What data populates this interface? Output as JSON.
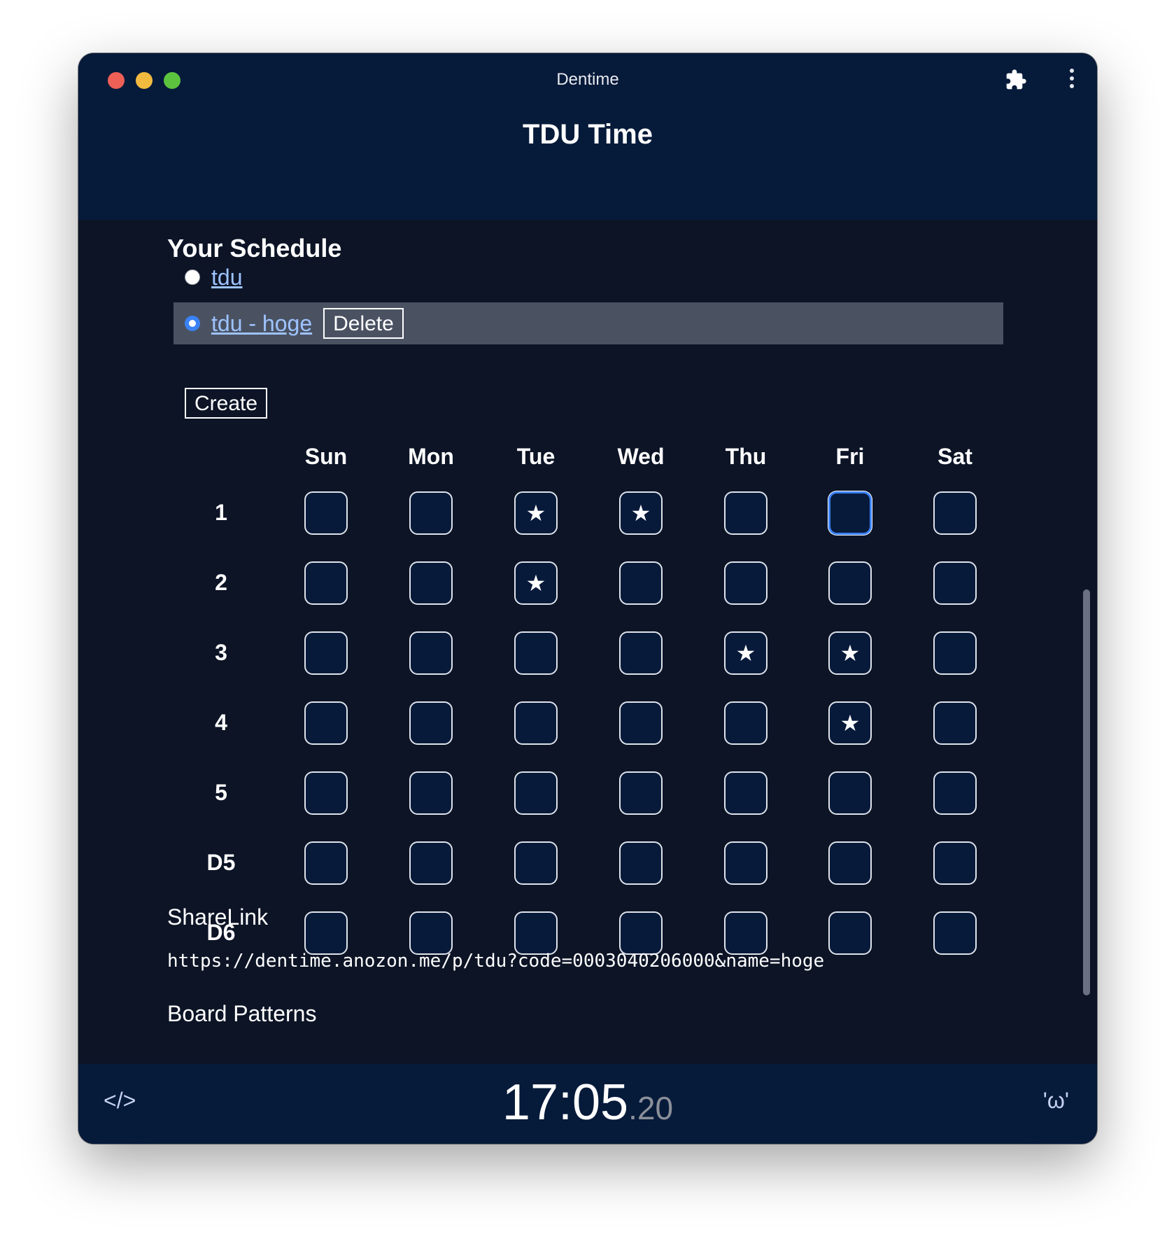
{
  "window": {
    "title": "Dentime"
  },
  "header": {
    "title": "TDU Time"
  },
  "schedule": {
    "heading": "Your Schedule",
    "items": [
      {
        "label": "tdu",
        "selected": false
      },
      {
        "label": "tdu - hoge",
        "selected": true
      }
    ],
    "delete_label": "Delete",
    "create_label": "Create"
  },
  "timetable": {
    "days": [
      "Sun",
      "Mon",
      "Tue",
      "Wed",
      "Thu",
      "Fri",
      "Sat"
    ],
    "periods": [
      "1",
      "2",
      "3",
      "4",
      "5",
      "D5",
      "D6"
    ],
    "starred": [
      [
        false,
        false,
        true,
        true,
        false,
        false,
        false
      ],
      [
        false,
        false,
        true,
        false,
        false,
        false,
        false
      ],
      [
        false,
        false,
        false,
        false,
        true,
        true,
        false
      ],
      [
        false,
        false,
        false,
        false,
        false,
        true,
        false
      ],
      [
        false,
        false,
        false,
        false,
        false,
        false,
        false
      ],
      [
        false,
        false,
        false,
        false,
        false,
        false,
        false
      ],
      [
        false,
        false,
        false,
        false,
        false,
        false,
        false
      ]
    ],
    "focused": {
      "period": 0,
      "day": 5
    },
    "star_glyph": "★"
  },
  "share": {
    "label": "ShareLink",
    "url": "https://dentime.anozon.me/p/tdu?code=0003040206000&name=hoge"
  },
  "board_patterns": {
    "label": "Board Patterns"
  },
  "footer": {
    "left_label": "</>",
    "clock_main": "17:05",
    "clock_frac": ".20",
    "right_label": "'ω'"
  },
  "colors": {
    "background": "#0c1426",
    "header": "#061a3a",
    "accent": "#3b82f6",
    "link": "#9ec3ff",
    "selected_row": "#4a5262"
  }
}
